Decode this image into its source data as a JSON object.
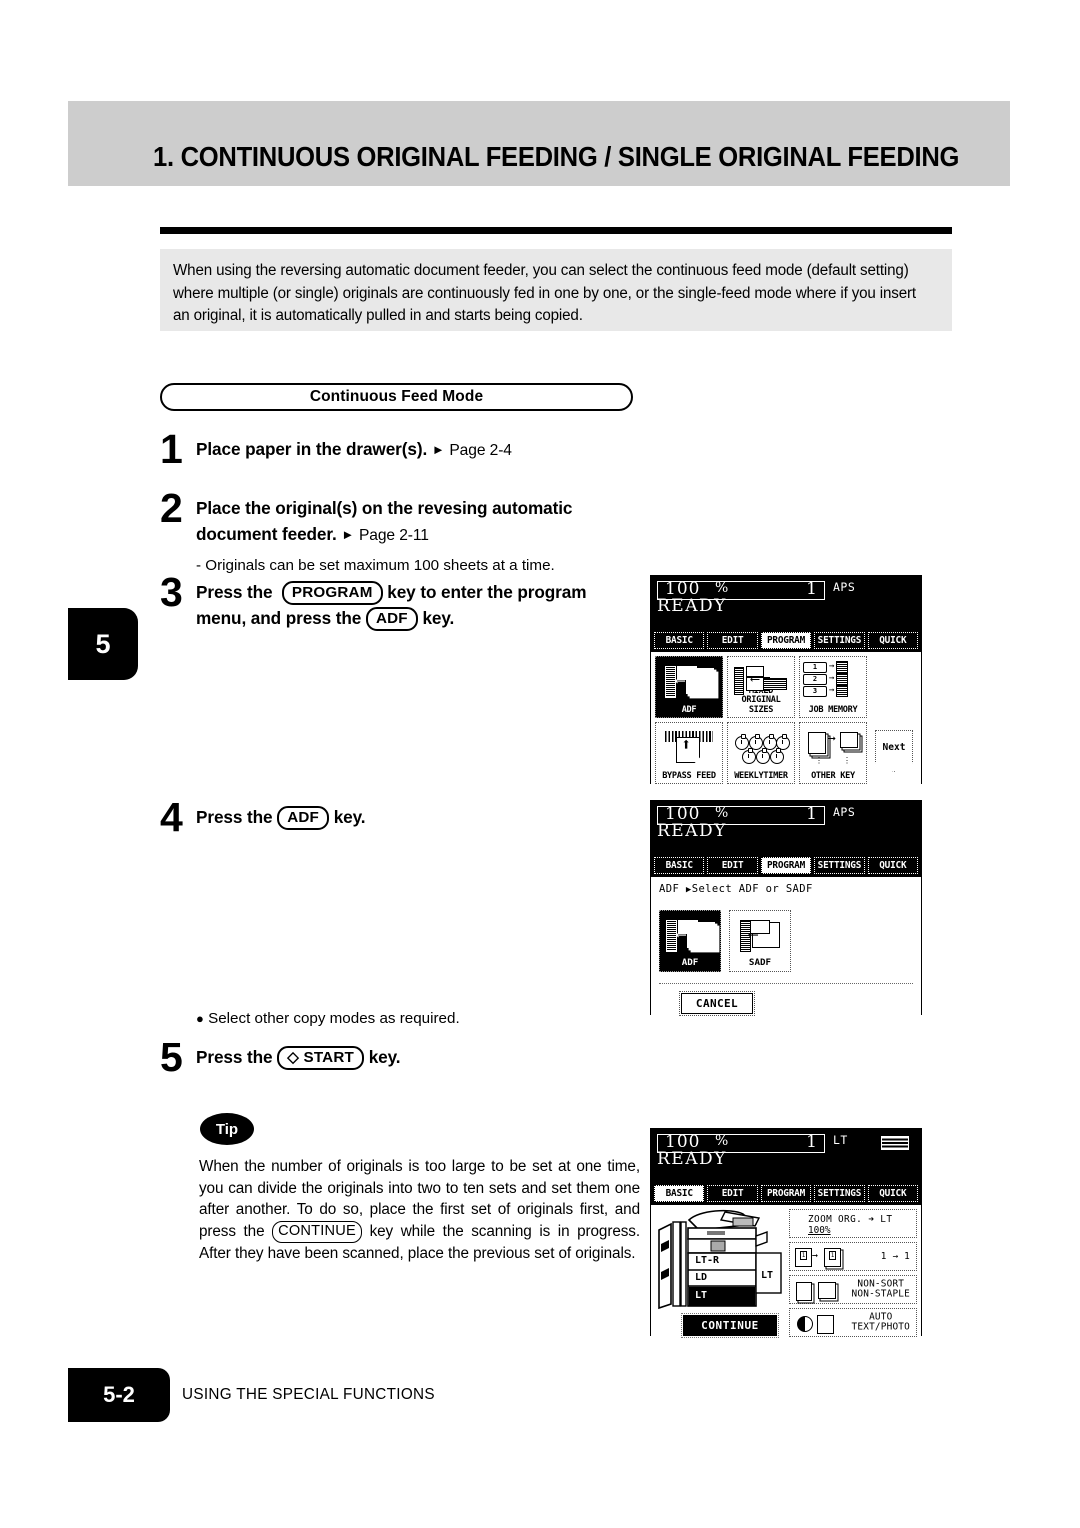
{
  "page": {
    "chapter_tab": "5",
    "footer_page": "5-2",
    "footer_label": "USING THE SPECIAL FUNCTIONS"
  },
  "header": {
    "title": "1. CONTINUOUS ORIGINAL FEEDING / SINGLE ORIGINAL FEEDING"
  },
  "intro": {
    "text": "When using the reversing automatic document feeder, you can select the continuous feed mode (default setting) where multiple (or single) originals are continuously fed in one by one, or the single-feed mode where if you insert an original, it is automatically pulled in and starts being copied."
  },
  "section": {
    "pill_label": "Continuous Feed Mode"
  },
  "steps": [
    {
      "number": "1",
      "title": "Place paper in the drawer(s).",
      "ref": "Page 2-4"
    },
    {
      "number": "2",
      "title_line1": "Place the original(s) on the revesing automatic",
      "title_line2": "document feeder.",
      "ref": "Page  2-11",
      "note": "-  Originals can be set maximum 100 sheets at a time."
    },
    {
      "number": "3",
      "title_a": "Press the",
      "key1": "PROGRAM",
      "title_b": "key to enter the program",
      "title_c": "menu, and press the",
      "key2": "ADF",
      "title_d": "key."
    },
    {
      "number": "4",
      "title_a": "Press the",
      "key1": "ADF",
      "title_b": "key."
    },
    {
      "number": "5",
      "title_a": "Press the",
      "key1": "START",
      "key1_glyph": "◇",
      "title_b": "key."
    }
  ],
  "bullet_note": "Select other copy modes as required.",
  "tip": {
    "badge": "Tip",
    "text_a": "When the number of originals is too large to be set at one time, you can divide the originals into two to ten sets and set them one after another.  To do so, place the first set of originals first, and press the",
    "key": "CONTINUE",
    "text_b": "key while the scanning is in progress. After they have been scanned, place the previous set of originals."
  },
  "lcd_panels": [
    {
      "id": "panel-program-menu",
      "status": {
        "ratio": "100",
        "percent_symbol": "%",
        "copies": "1",
        "mode": "APS",
        "ready": "READY",
        "paper_indicator": false
      },
      "tabs": [
        {
          "label": "BASIC",
          "active": false
        },
        {
          "label": "EDIT",
          "active": false
        },
        {
          "label": "PROGRAM",
          "active": true
        },
        {
          "label": "SETTINGS",
          "active": false
        },
        {
          "label": "QUICK",
          "active": false
        }
      ],
      "buttons": [
        {
          "label": "ADF",
          "icon": "adf-icon",
          "selected": true
        },
        {
          "label_line1": "MIXED",
          "label_line2": "ORIGINAL SIZES",
          "icon": "mixed-original-sizes-icon",
          "selected": false
        },
        {
          "label": "JOB MEMORY",
          "icon": "job-memory-icon",
          "selected": false,
          "rows": [
            "1",
            "2",
            "3"
          ]
        },
        {
          "label": "BYPASS FEED",
          "icon": "bypass-feed-icon",
          "selected": false
        },
        {
          "label": "WEEKLYTIMER",
          "icon": "weekly-timer-icon",
          "selected": false
        },
        {
          "label": "OTHER KEY",
          "icon": "other-key-icon",
          "selected": false
        }
      ],
      "next_label": "Next"
    },
    {
      "id": "panel-adf-select",
      "status": {
        "ratio": "100",
        "percent_symbol": "%",
        "copies": "1",
        "mode": "APS",
        "ready": "READY",
        "paper_indicator": false
      },
      "tabs": [
        {
          "label": "BASIC",
          "active": false
        },
        {
          "label": "EDIT",
          "active": false
        },
        {
          "label": "PROGRAM",
          "active": true
        },
        {
          "label": "SETTINGS",
          "active": false
        },
        {
          "label": "QUICK",
          "active": false
        }
      ],
      "caption_prefix": "ADF",
      "caption_arrow": "▶",
      "caption": "Select ADF or SADF",
      "buttons": [
        {
          "label": "ADF",
          "icon": "adf-icon",
          "selected": true
        },
        {
          "label": "SADF",
          "icon": "sadf-icon",
          "selected": false
        }
      ],
      "cancel_label": "CANCEL"
    },
    {
      "id": "panel-basic",
      "status": {
        "ratio": "100",
        "percent_symbol": "%",
        "copies": "1",
        "mode": "LT",
        "ready": "READY",
        "paper_indicator": true
      },
      "tabs": [
        {
          "label": "BASIC",
          "active": true
        },
        {
          "label": "EDIT",
          "active": false
        },
        {
          "label": "PROGRAM",
          "active": false
        },
        {
          "label": "SETTINGS",
          "active": false
        },
        {
          "label": "QUICK",
          "active": false
        }
      ],
      "drawers": [
        {
          "label": "LT-R",
          "selected": false
        },
        {
          "label": "LD",
          "selected": false
        },
        {
          "label": "LT",
          "selected": true
        }
      ],
      "bypass_label": "LT",
      "continue_label": "CONTINUE",
      "settings": [
        {
          "name": "zoom-setting",
          "a": "ZOOM",
          "b": "ORG. ➜ LT",
          "c": "100%"
        },
        {
          "name": "duplex-setting",
          "text": "1 → 1"
        },
        {
          "name": "finisher-setting",
          "line1": "NON-SORT",
          "line2": "NON-STAPLE"
        },
        {
          "name": "original-mode-setting",
          "line1": "AUTO",
          "line2": "TEXT/PHOTO"
        }
      ]
    }
  ]
}
